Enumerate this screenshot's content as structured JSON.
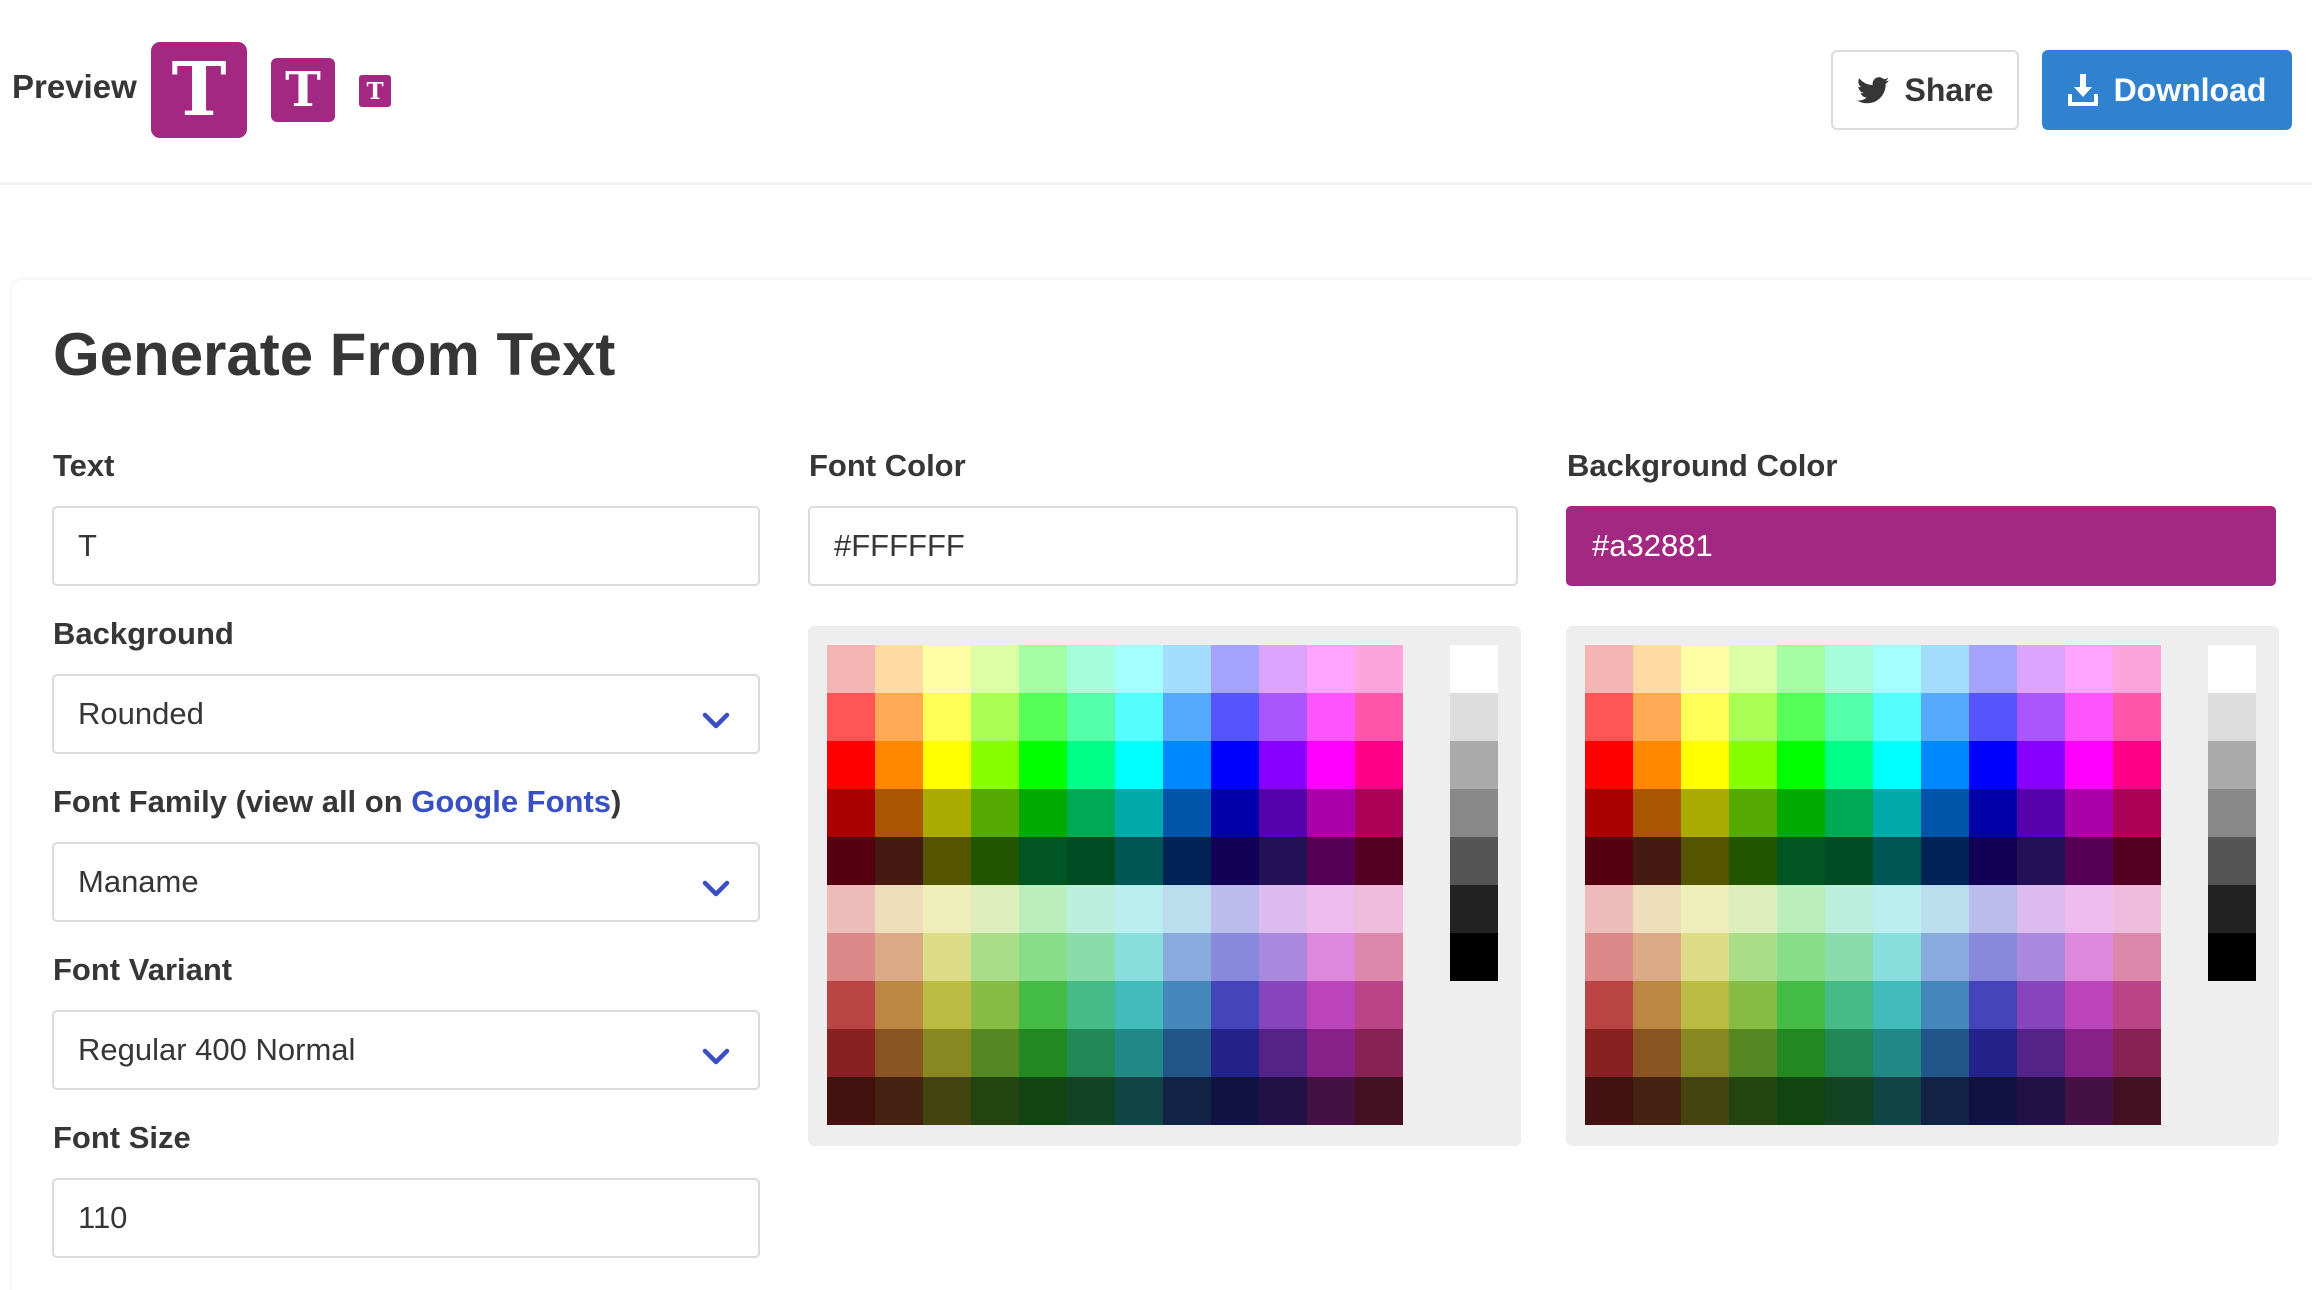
{
  "header": {
    "preview_label": "Preview",
    "favicon_letter": "T",
    "favicon_color": "#a32881",
    "share_label": "Share",
    "download_label": "Download"
  },
  "card": {
    "title": "Generate From Text"
  },
  "form": {
    "text_label": "Text",
    "text_value": "T",
    "background_label": "Background",
    "background_value": "Rounded",
    "font_family_label_prefix": "Font Family (view all on ",
    "font_family_link": "Google Fonts",
    "font_family_label_suffix": ")",
    "font_family_value": "Maname",
    "font_variant_label": "Font Variant",
    "font_variant_value": "Regular 400 Normal",
    "font_size_label": "Font Size",
    "font_size_value": "110",
    "font_color_label": "Font Color",
    "font_color_value": "#FFFFFF",
    "bg_color_label": "Background Color",
    "bg_color_value": "#a32881"
  },
  "palette": {
    "columns": [
      "red",
      "orange",
      "yellow",
      "lime",
      "green",
      "spring",
      "teal",
      "cyan",
      "blue",
      "indigo",
      "violet",
      "magenta"
    ],
    "rows": [
      [
        "#f4b4b4",
        "#fedba4",
        "#fefea4",
        "#dcfea4",
        "#a4fea4",
        "#a4fedc",
        "#a4fefe",
        "#a4dcfe",
        "#a4a4fe",
        "#dca4fe",
        "#fea4fe",
        "#fea4dc"
      ],
      [
        "#ff5555",
        "#ffaa55",
        "#ffff55",
        "#aaff55",
        "#55ff55",
        "#55ffaa",
        "#55ffff",
        "#55aaff",
        "#5555ff",
        "#aa55ff",
        "#ff55ff",
        "#ff55aa"
      ],
      [
        "#ff0000",
        "#ff8800",
        "#ffff00",
        "#88ff00",
        "#00ff00",
        "#00ff88",
        "#00ffff",
        "#0088ff",
        "#0000ff",
        "#8800ff",
        "#ff00ff",
        "#ff0088"
      ],
      [
        "#aa0000",
        "#aa5500",
        "#aaaa00",
        "#55aa00",
        "#00aa00",
        "#00aa55",
        "#00aaaa",
        "#0055aa",
        "#0000aa",
        "#5500aa",
        "#aa00aa",
        "#aa0055"
      ],
      [
        "#550011",
        "#441a11",
        "#555500",
        "#225500",
        "#005522",
        "#004c22",
        "#005555",
        "#002255",
        "#110055",
        "#221155",
        "#550055",
        "#550022"
      ],
      [
        "#eebbbb",
        "#eeddbb",
        "#eeeebb",
        "#ddeebb",
        "#bbeebb",
        "#bbeedd",
        "#bbeeee",
        "#bbddee",
        "#bbbbee",
        "#ddbbee",
        "#eebbee",
        "#eebbdd"
      ],
      [
        "#dd8888",
        "#ddaa88",
        "#dddd88",
        "#aadd88",
        "#88dd88",
        "#88ddaa",
        "#88dddd",
        "#88aadd",
        "#8888dd",
        "#aa88dd",
        "#dd88dd",
        "#dd88aa"
      ],
      [
        "#bb4444",
        "#bb8844",
        "#bbbb44",
        "#88bb44",
        "#44bb44",
        "#44bb88",
        "#44bbbb",
        "#4488bb",
        "#4444bb",
        "#8844bb",
        "#bb44bb",
        "#bb4488"
      ],
      [
        "#882222",
        "#885522",
        "#888822",
        "#558822",
        "#228822",
        "#228855",
        "#228888",
        "#225588",
        "#222288",
        "#552288",
        "#882288",
        "#882255"
      ],
      [
        "#441111",
        "#442211",
        "#444411",
        "#224411",
        "#114411",
        "#114422",
        "#114444",
        "#112244",
        "#111144",
        "#221144",
        "#441144",
        "#441122"
      ]
    ],
    "grays": [
      "#ffffff",
      "#dddddd",
      "#aaaaaa",
      "#888888",
      "#555555",
      "#222222",
      "#000000"
    ]
  }
}
